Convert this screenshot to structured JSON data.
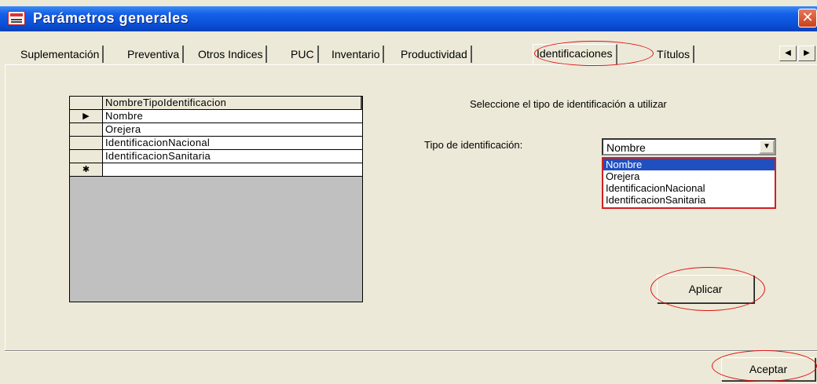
{
  "window": {
    "title": "Parámetros generales",
    "close_glyph": "✕",
    "icon": "app-form-icon"
  },
  "tabs": [
    {
      "label": "Suplementación",
      "active": false
    },
    {
      "label": "Preventiva",
      "active": false
    },
    {
      "label": "Otros Indices",
      "active": false
    },
    {
      "label": "PUC",
      "active": false
    },
    {
      "label": "Inventario",
      "active": false
    },
    {
      "label": "Productividad",
      "active": false
    },
    {
      "label": "Identificaciones",
      "active": true
    },
    {
      "label": "Títulos",
      "active": false
    }
  ],
  "tab_scroll": {
    "left": "◀",
    "right": "▶"
  },
  "grid": {
    "header": "NombreTipoIdentificacion",
    "rows": [
      {
        "selector": "▶",
        "value": "Nombre"
      },
      {
        "selector": "",
        "value": "Orejera"
      },
      {
        "selector": "",
        "value": "IdentificacionNacional"
      },
      {
        "selector": "",
        "value": "IdentificacionSanitaria"
      },
      {
        "selector": "✱",
        "value": ""
      }
    ]
  },
  "instruction": "Seleccione el tipo de identificación a utilizar",
  "combo": {
    "label": "Tipo de identificación:",
    "value": "Nombre",
    "arrow": "▼",
    "options": [
      "Nombre",
      "Orejera",
      "IdentificacionNacional",
      "IdentificacionSanitaria"
    ],
    "selected_index": 0
  },
  "buttons": {
    "apply": "Aplicar",
    "accept": "Aceptar"
  },
  "annotation_color": "#e01010"
}
